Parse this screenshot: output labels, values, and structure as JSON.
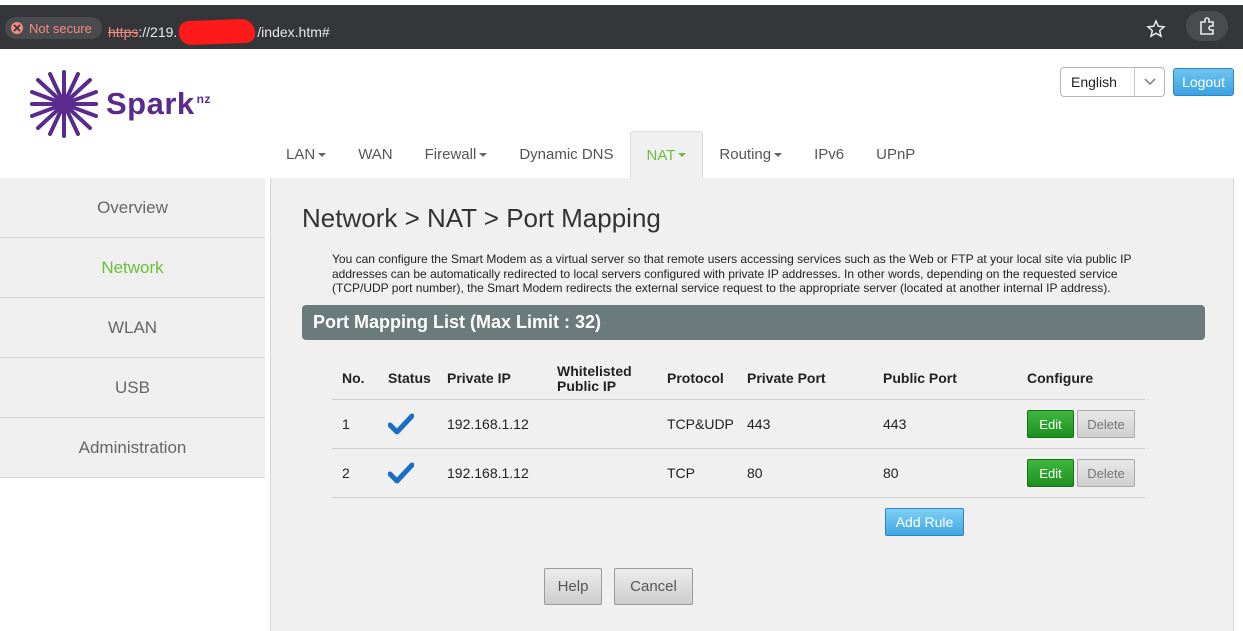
{
  "browser": {
    "security_label": "Not secure",
    "url_scheme": "https",
    "url_prefix": "://219.",
    "url_suffix": "/index.htm#",
    "icons": [
      "close-circle-icon",
      "star-icon",
      "extensions-icon"
    ]
  },
  "header": {
    "brand": "Spark",
    "brand_sup": "nz",
    "language": "English",
    "logout_label": "Logout",
    "colors": {
      "brand": "#5a2a8c",
      "active": "#6dbd3c",
      "accent": "#3aa3e0"
    }
  },
  "nav": {
    "tabs": [
      {
        "label": "LAN",
        "dropdown": true,
        "active": false
      },
      {
        "label": "WAN",
        "dropdown": false,
        "active": false
      },
      {
        "label": "Firewall",
        "dropdown": true,
        "active": false
      },
      {
        "label": "Dynamic DNS",
        "dropdown": false,
        "active": false
      },
      {
        "label": "NAT",
        "dropdown": true,
        "active": true
      },
      {
        "label": "Routing",
        "dropdown": true,
        "active": false
      },
      {
        "label": "IPv6",
        "dropdown": false,
        "active": false
      },
      {
        "label": "UPnP",
        "dropdown": false,
        "active": false
      }
    ]
  },
  "sidebar": {
    "items": [
      {
        "label": "Overview",
        "active": false
      },
      {
        "label": "Network",
        "active": true
      },
      {
        "label": "WLAN",
        "active": false
      },
      {
        "label": "USB",
        "active": false
      },
      {
        "label": "Administration",
        "active": false
      }
    ]
  },
  "main": {
    "title": "Network > NAT > Port Mapping",
    "description": "You can configure the Smart Modem as a virtual server so that remote users accessing services such as the Web or FTP at your local site via public IP addresses can be automatically redirected to local servers configured with private IP addresses. In other words, depending on the requested service (TCP/UDP port number), the Smart Modem redirects the external service request to the appropriate server (located at another internal IP address).",
    "list_title": "Port Mapping List (Max Limit : 32)",
    "columns": {
      "no": "No.",
      "status": "Status",
      "private_ip": "Private IP",
      "whitelisted_1": "Whitelisted",
      "whitelisted_2": "Public IP",
      "protocol": "Protocol",
      "private_port": "Private Port",
      "public_port": "Public Port",
      "configure": "Configure"
    },
    "rows": [
      {
        "no": "1",
        "status": "enabled",
        "private_ip": "192.168.1.12",
        "whitelisted_ip": "",
        "protocol": "TCP&UDP",
        "private_port": "443",
        "public_port": "443"
      },
      {
        "no": "2",
        "status": "enabled",
        "private_ip": "192.168.1.12",
        "whitelisted_ip": "",
        "protocol": "TCP",
        "private_port": "80",
        "public_port": "80"
      }
    ],
    "edit_label": "Edit",
    "delete_label": "Delete",
    "add_rule_label": "Add Rule",
    "help_label": "Help",
    "cancel_label": "Cancel"
  }
}
